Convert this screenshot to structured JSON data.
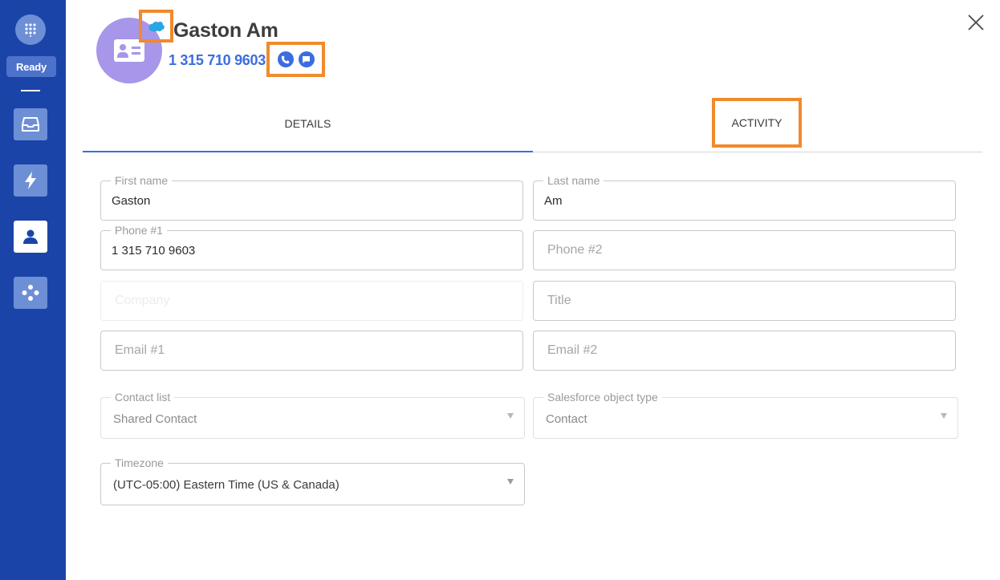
{
  "sidebar": {
    "status_label": "Ready",
    "items": [
      {
        "name": "inbox"
      },
      {
        "name": "lightning"
      },
      {
        "name": "contacts",
        "active": true
      },
      {
        "name": "integrations"
      }
    ]
  },
  "header": {
    "name": "Gaston Am",
    "phone": "1 315 710 9603"
  },
  "tabs": [
    {
      "label": "DETAILS",
      "active": true
    },
    {
      "label": "ACTIVITY",
      "active": false
    }
  ],
  "form": {
    "first_name": {
      "label": "First name",
      "value": "Gaston"
    },
    "last_name": {
      "label": "Last name",
      "value": "Am"
    },
    "phone1": {
      "label": "Phone #1",
      "value": "1 315 710 9603"
    },
    "phone2": {
      "placeholder": "Phone #2"
    },
    "company": {
      "placeholder": "Company"
    },
    "title": {
      "placeholder": "Title"
    },
    "email1": {
      "placeholder": "Email #1"
    },
    "email2": {
      "placeholder": "Email #2"
    },
    "contact_list": {
      "label": "Contact list",
      "value": "Shared Contact"
    },
    "sf_object_type": {
      "label": "Salesforce object type",
      "value": "Contact"
    },
    "timezone": {
      "label": "Timezone",
      "value": "(UTC-05:00) Eastern Time (US & Canada)"
    }
  },
  "colors": {
    "sidebar": "#1a44a8",
    "accent": "#3b6de0",
    "avatar": "#a796ea",
    "highlight": "#f18a2c",
    "salesforce": "#2aa7e3"
  }
}
